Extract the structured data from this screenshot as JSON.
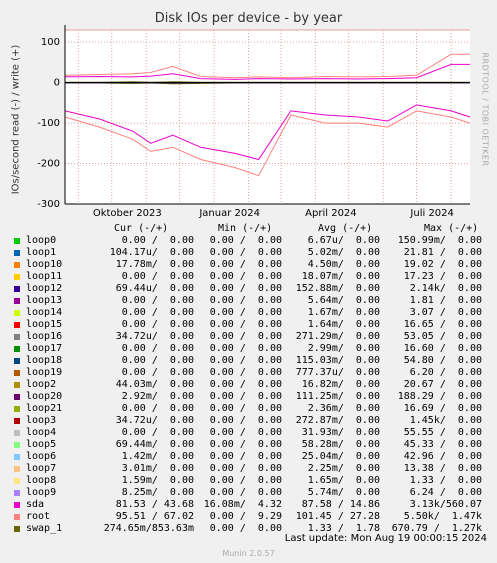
{
  "title": "Disk IOs per device - by year",
  "ylabel": "IOs/second read (-) / write (+)",
  "side_label": "RRDTOOL / TOBI OETIKER",
  "last_update": "Last update: Mon Aug 19 00:00:15 2024",
  "footer": "Munin 2.0.57",
  "legend_headers": {
    "cur": "Cur (-/+)",
    "min": "Min (-/+)",
    "avg": "Avg (-/+)",
    "max": "Max (-/+)"
  },
  "rows": [
    {
      "name": "loop0",
      "color": "#00cc00",
      "cur": "0.00 /  0.00",
      "min": "0.00 /  0.00",
      "avg": "6.67u/  0.00",
      "max": "150.99m/  0.00"
    },
    {
      "name": "loop1",
      "color": "#0066b3",
      "cur": "104.17u/  0.00",
      "min": "0.00 /  0.00",
      "avg": "5.02m/  0.00",
      "max": "21.81 /  0.00"
    },
    {
      "name": "loop10",
      "color": "#ff8000",
      "cur": "17.78m/  0.00",
      "min": "0.00 /  0.00",
      "avg": "4.50m/  0.00",
      "max": "19.02 /  0.00"
    },
    {
      "name": "loop11",
      "color": "#ffcc00",
      "cur": "0.00 /  0.00",
      "min": "0.00 /  0.00",
      "avg": "18.07m/  0.00",
      "max": "17.23 /  0.00"
    },
    {
      "name": "loop12",
      "color": "#330099",
      "cur": "69.44u/  0.00",
      "min": "0.00 /  0.00",
      "avg": "152.88m/  0.00",
      "max": "2.14k/  0.00"
    },
    {
      "name": "loop13",
      "color": "#990099",
      "cur": "0.00 /  0.00",
      "min": "0.00 /  0.00",
      "avg": "5.64m/  0.00",
      "max": "1.81 /  0.00"
    },
    {
      "name": "loop14",
      "color": "#ccff00",
      "cur": "0.00 /  0.00",
      "min": "0.00 /  0.00",
      "avg": "1.67m/  0.00",
      "max": "3.07 /  0.00"
    },
    {
      "name": "loop15",
      "color": "#ff0000",
      "cur": "0.00 /  0.00",
      "min": "0.00 /  0.00",
      "avg": "1.64m/  0.00",
      "max": "16.65 /  0.00"
    },
    {
      "name": "loop16",
      "color": "#808080",
      "cur": "34.72u/  0.00",
      "min": "0.00 /  0.00",
      "avg": "271.29m/  0.00",
      "max": "53.05 /  0.00"
    },
    {
      "name": "loop17",
      "color": "#008f00",
      "cur": "0.00 /  0.00",
      "min": "0.00 /  0.00",
      "avg": "2.99m/  0.00",
      "max": "16.60 /  0.00"
    },
    {
      "name": "loop18",
      "color": "#00487d",
      "cur": "0.00 /  0.00",
      "min": "0.00 /  0.00",
      "avg": "115.03m/  0.00",
      "max": "54.80 /  0.00"
    },
    {
      "name": "loop19",
      "color": "#b35a00",
      "cur": "0.00 /  0.00",
      "min": "0.00 /  0.00",
      "avg": "777.37u/  0.00",
      "max": "6.20 /  0.00"
    },
    {
      "name": "loop2",
      "color": "#b38f00",
      "cur": "44.03m/  0.00",
      "min": "0.00 /  0.00",
      "avg": "16.82m/  0.00",
      "max": "20.67 /  0.00"
    },
    {
      "name": "loop20",
      "color": "#6b006b",
      "cur": "2.92m/  0.00",
      "min": "0.00 /  0.00",
      "avg": "111.25m/  0.00",
      "max": "188.29 /  0.00"
    },
    {
      "name": "loop21",
      "color": "#8fb300",
      "cur": "0.00 /  0.00",
      "min": "0.00 /  0.00",
      "avg": "2.36m/  0.00",
      "max": "16.69 /  0.00"
    },
    {
      "name": "loop3",
      "color": "#b30000",
      "cur": "34.72u/  0.00",
      "min": "0.00 /  0.00",
      "avg": "272.87m/  0.00",
      "max": "1.45k/  0.00"
    },
    {
      "name": "loop4",
      "color": "#bebebe",
      "cur": "0.00 /  0.00",
      "min": "0.00 /  0.00",
      "avg": "31.93m/  0.00",
      "max": "55.55 /  0.00"
    },
    {
      "name": "loop5",
      "color": "#80ff80",
      "cur": "69.44m/  0.00",
      "min": "0.00 /  0.00",
      "avg": "58.28m/  0.00",
      "max": "45.33 /  0.00"
    },
    {
      "name": "loop6",
      "color": "#80c9ff",
      "cur": "1.42m/  0.00",
      "min": "0.00 /  0.00",
      "avg": "25.04m/  0.00",
      "max": "42.96 /  0.00"
    },
    {
      "name": "loop7",
      "color": "#ffc080",
      "cur": "3.01m/  0.00",
      "min": "0.00 /  0.00",
      "avg": "2.25m/  0.00",
      "max": "13.38 /  0.00"
    },
    {
      "name": "loop8",
      "color": "#ffe680",
      "cur": "1.59m/  0.00",
      "min": "0.00 /  0.00",
      "avg": "1.65m/  0.00",
      "max": "1.33 /  0.00"
    },
    {
      "name": "loop9",
      "color": "#aa80ff",
      "cur": "8.25m/  0.00",
      "min": "0.00 /  0.00",
      "avg": "5.74m/  0.00",
      "max": "6.24 /  0.00"
    },
    {
      "name": "sda",
      "color": "#ee00cc",
      "cur": "81.53 / 43.68",
      "min": "16.08m/  4.32",
      "avg": "87.58 / 14.86",
      "max": "3.13k/560.07"
    },
    {
      "name": "root",
      "color": "#ff8080",
      "cur": "95.51 / 67.02",
      "min": "0.00 /  9.29",
      "avg": "101.45 / 27.28",
      "max": "5.50k/  1.47k"
    },
    {
      "name": "swap_1",
      "color": "#666600",
      "cur": "274.65m/853.63m",
      "min": "0.00 /  0.00",
      "avg": "1.33 /  1.78",
      "max": "670.79 /  1.27k"
    }
  ],
  "chart_data": {
    "type": "line",
    "title": "Disk IOs per device - by year",
    "xlabel": "",
    "ylabel": "IOs/second read (-) / write (+)",
    "ylim": [
      -300,
      130
    ],
    "yticks": [
      -300,
      -200,
      -100,
      0,
      100
    ],
    "xticks": [
      "Oktober 2023",
      "Januar 2024",
      "April 2024",
      "Juli 2024"
    ],
    "x_dates": [
      "2023-08-20",
      "2023-09-20",
      "2023-10-20",
      "2023-11-05",
      "2023-11-25",
      "2023-12-20",
      "2024-01-20",
      "2024-02-10",
      "2024-03-10",
      "2024-04-10",
      "2024-05-10",
      "2024-06-05",
      "2024-07-01",
      "2024-08-01",
      "2024-08-18"
    ],
    "series": [
      {
        "name": "sda",
        "color": "#ee00cc",
        "write": [
          14,
          15,
          14,
          16,
          22,
          10,
          8,
          10,
          9,
          10,
          9,
          10,
          12,
          45,
          45
        ],
        "read": [
          -70,
          -90,
          -120,
          -150,
          -130,
          -160,
          -175,
          -190,
          -70,
          -80,
          -85,
          -95,
          -55,
          -70,
          -85
        ]
      },
      {
        "name": "root",
        "color": "#ff8080",
        "write": [
          18,
          20,
          22,
          25,
          40,
          15,
          12,
          14,
          12,
          15,
          14,
          15,
          18,
          70,
          70
        ],
        "read": [
          -85,
          -110,
          -140,
          -170,
          -160,
          -190,
          -210,
          -230,
          -80,
          -100,
          -100,
          -110,
          -70,
          -85,
          -100
        ]
      },
      {
        "name": "swap_1",
        "color": "#666600",
        "write": [
          1,
          1,
          2,
          1,
          2,
          1,
          1,
          1,
          1,
          1,
          1,
          1,
          1,
          1,
          1
        ],
        "read": [
          -1,
          -1,
          -2,
          -1,
          -3,
          -2,
          -1,
          -1,
          -1,
          -1,
          -1,
          -1,
          -1,
          -1,
          -1
        ]
      },
      {
        "name": "loop12",
        "color": "#330099",
        "write": [
          0,
          0,
          0,
          0,
          0,
          0,
          0,
          0,
          0,
          0,
          0,
          0,
          0,
          0,
          0
        ],
        "read": [
          0,
          0,
          0,
          0,
          -1,
          0,
          0,
          0,
          0,
          0,
          0,
          0,
          0,
          0,
          0
        ]
      }
    ]
  }
}
